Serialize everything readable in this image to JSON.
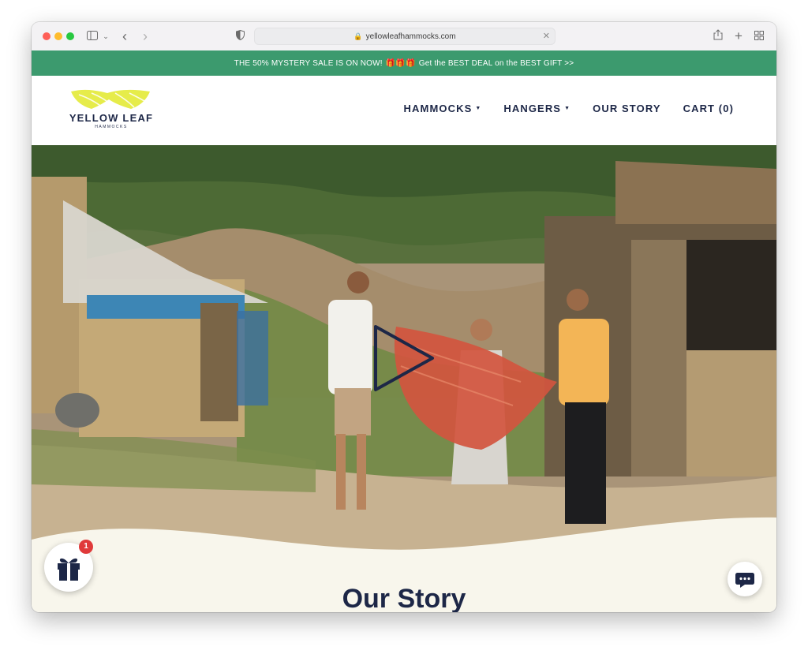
{
  "browser": {
    "url": "yellowleafhammocks.com"
  },
  "promo": {
    "text": "THE 50% MYSTERY SALE IS ON NOW!",
    "emoji": "🎁🎁🎁",
    "cta": "Get the BEST DEAL on the BEST GIFT >>"
  },
  "logo": {
    "name": "YELLOW LEAF",
    "sub": "HAMMOCKS"
  },
  "nav": {
    "items": [
      {
        "label": "HAMMOCKS",
        "caret": "▼"
      },
      {
        "label": "HANGERS",
        "caret": "▼"
      },
      {
        "label": "OUR STORY"
      },
      {
        "label": "CART (0)"
      }
    ]
  },
  "section": {
    "title": "Our Story"
  },
  "widgets": {
    "gift_badge": "1"
  },
  "colors": {
    "promo_bg": "#3c9a6e",
    "navy": "#1d2747",
    "logo_yellow": "#e6ec4a",
    "cream": "#f8f6ec"
  }
}
